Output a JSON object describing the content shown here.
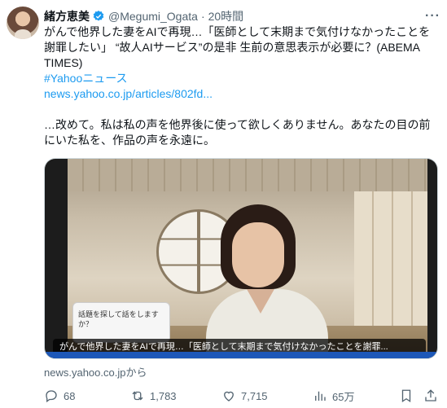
{
  "author": {
    "name": "緒方恵美",
    "handle": "@Megumi_Ogata",
    "dot": "·",
    "time": "20時間"
  },
  "more_icon": "more-horizontal-icon",
  "tweet": {
    "line1": "がんで他界した妻をAIで再現…「医師として末期まで気付けなかったことを謝罪したい」 “故人AIサービス”の是非 生前の意思表示が必要に？(ABEMA TIMES)",
    "hashtag": "#Yahooニュース",
    "url": "news.yahoo.co.jp/articles/802fd...",
    "comment": "…改めて。私は私の声を他界後に使って欲しくありません。あなたの目の前にいた私を、作品の声を永遠に。"
  },
  "media": {
    "sign_text": "話題を探して話をしますか？",
    "caption": "がんで他界した妻をAIで再現…「医師として末期まで気付けなかったことを謝罪..."
  },
  "source_label": "news.yahoo.co.jpから",
  "actions": {
    "replies": "68",
    "reposts": "1,783",
    "likes": "7,715",
    "views": "65万"
  }
}
